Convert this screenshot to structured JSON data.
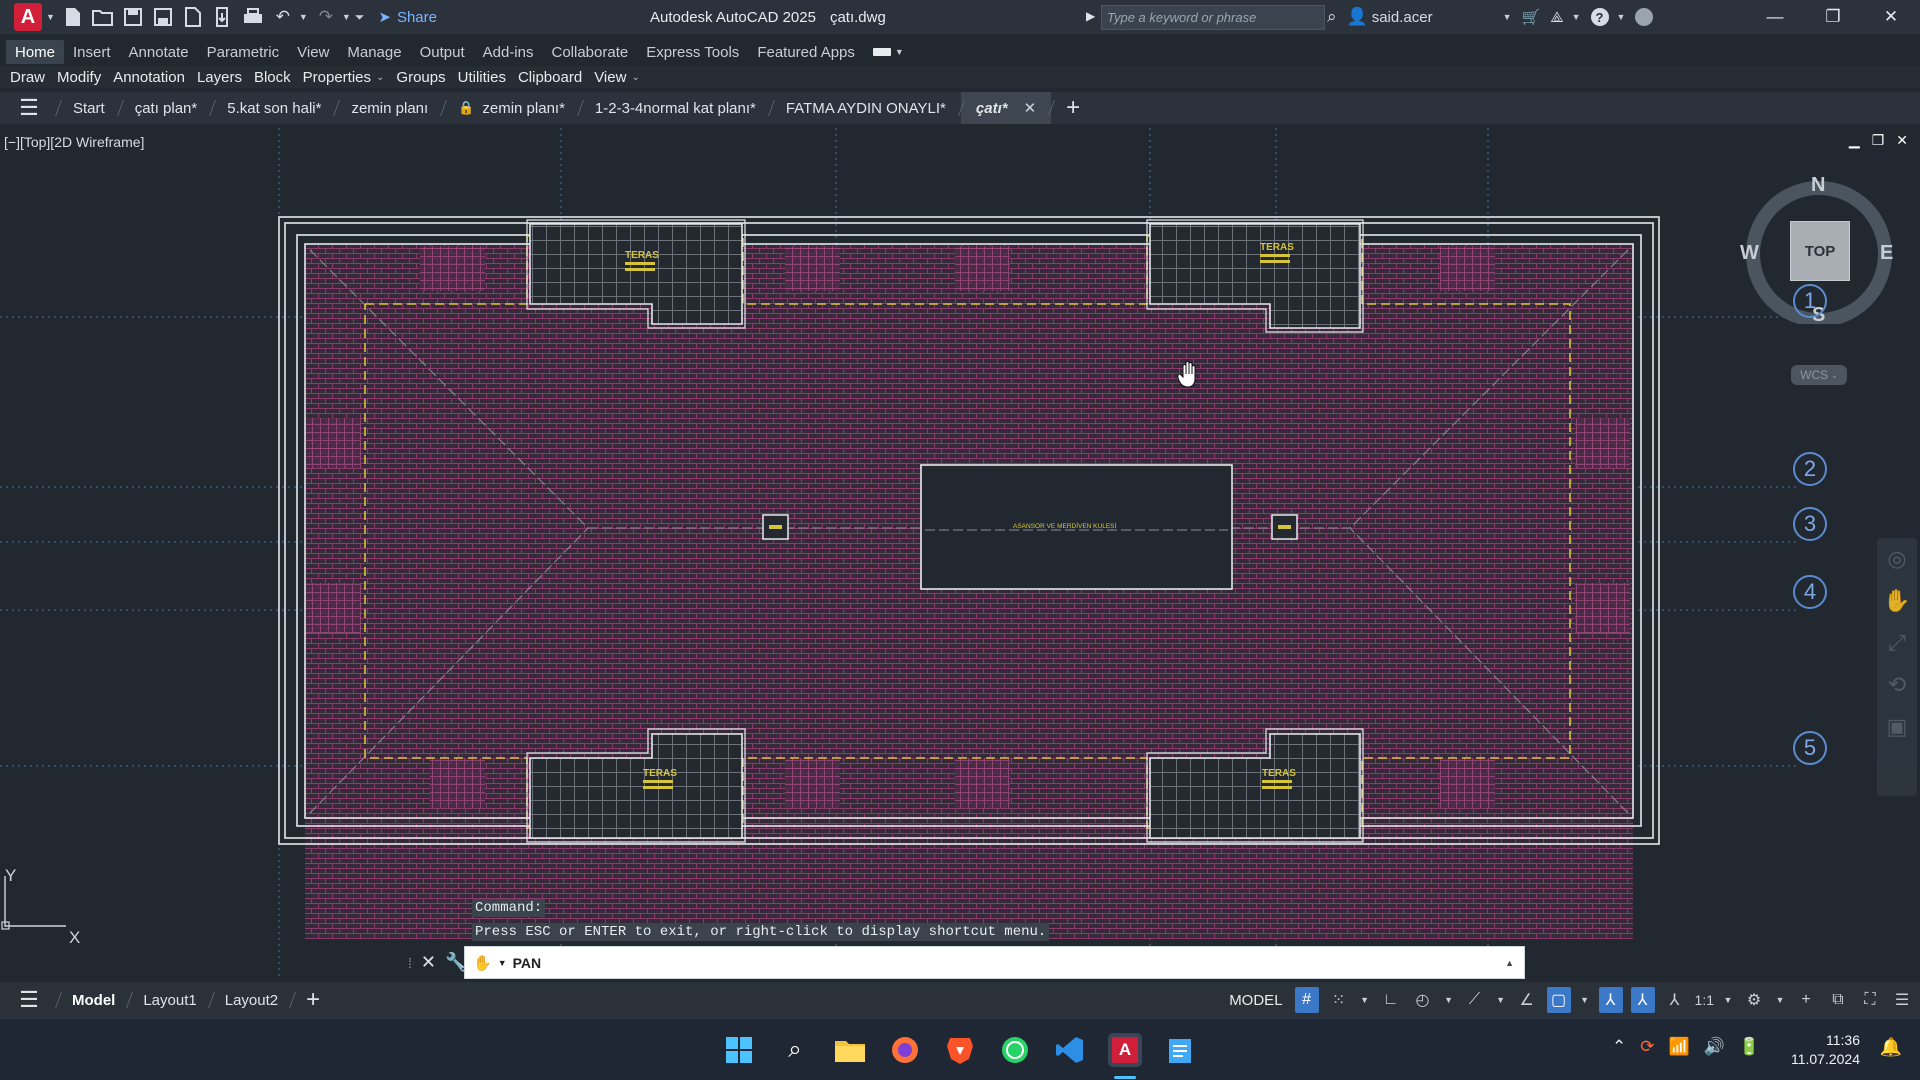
{
  "app": {
    "title": "Autodesk AutoCAD 2025",
    "file": "çatı.dwg",
    "share_label": "Share",
    "search_placeholder": "Type a keyword or phrase",
    "user": "said.acer"
  },
  "ribbon_tabs": [
    "Home",
    "Insert",
    "Annotate",
    "Parametric",
    "View",
    "Manage",
    "Output",
    "Add-ins",
    "Collaborate",
    "Express Tools",
    "Featured Apps"
  ],
  "ribbon_panels": [
    "Draw",
    "Modify",
    "Annotation",
    "Layers",
    "Block",
    "Properties",
    "Groups",
    "Utilities",
    "Clipboard",
    "View"
  ],
  "doc_tabs": {
    "start": "Start",
    "items": [
      "çatı plan*",
      "5.kat son hali*",
      "zemin planı",
      "zemin planı*",
      "1-2-3-4normal kat planı*",
      "FATMA AYDIN ONAYLI*",
      "çatı*"
    ]
  },
  "viewport": {
    "label": "[−][Top][2D Wireframe]",
    "viewcube": {
      "top": "TOP",
      "n": "N",
      "s": "S",
      "e": "E",
      "w": "W",
      "wcs": "WCS"
    },
    "ucs": {
      "x": "X",
      "y": "Y"
    },
    "grid_markers": [
      "1",
      "2",
      "3",
      "4",
      "5"
    ],
    "drawing": {
      "terrace_labels": [
        "TERAS",
        "TERAS",
        "TERAS",
        "TERAS"
      ],
      "core_label": "ASANSOR VE MERDİVEN KULESİ"
    }
  },
  "command": {
    "history": [
      "Command:",
      "Press ESC or ENTER to exit, or right-click to display shortcut menu."
    ],
    "current": "PAN"
  },
  "layout_tabs": [
    "Model",
    "Layout1",
    "Layout2"
  ],
  "status": {
    "model": "MODEL",
    "scale": "1:1"
  },
  "taskbar": {
    "time": "11:36",
    "date": "11.07.2024"
  },
  "colors": {
    "accent": "#3b78c8",
    "hatch": "#8a3a6b",
    "yellow": "#d6c43a",
    "autocad_red": "#d11f3a"
  }
}
